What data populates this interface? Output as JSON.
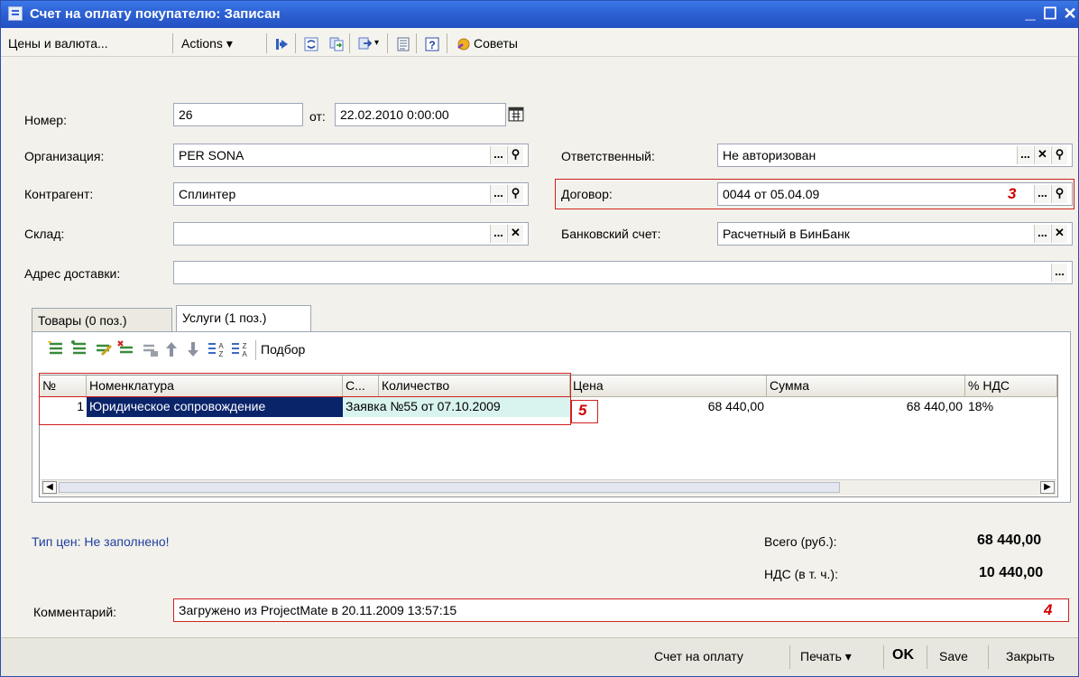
{
  "window": {
    "title": "Счет на оплату покупателю: Записан",
    "controls": [
      "_",
      "☐",
      "✕"
    ]
  },
  "toolbar": {
    "prices_label": "Цены и валюта...",
    "actions_label": "Actions",
    "tips_label": "Советы",
    "icons": [
      "arrow-icon",
      "refresh-icon",
      "copy-icon",
      "structure-icon",
      "list-icon",
      "help-icon",
      "tips-icon"
    ]
  },
  "form": {
    "number_label": "Номер:",
    "number_value": "26",
    "from_label": "от:",
    "date_value": "22.02.2010  0:00:00",
    "organization_label": "Организация:",
    "organization_value": "PER SONA",
    "responsible_label": "Ответственный:",
    "responsible_value": "Не авторизован",
    "counterparty_label": "Контрагент:",
    "counterparty_value": "Сплинтер",
    "contract_label": "Договор:",
    "contract_value": "0044 от 05.04.09",
    "contract_marker": "3",
    "warehouse_label": "Склад:",
    "warehouse_value": "",
    "bank_account_label": "Банковский счет:",
    "bank_account_value": "Расчетный в БинБанк",
    "delivery_label": "Адрес доставки:",
    "delivery_value": ""
  },
  "tabs": [
    {
      "label": "Товары (0 поз.)",
      "active": false
    },
    {
      "label": "Услуги (1 поз.)",
      "active": true
    }
  ],
  "table_toolbar": {
    "pick_label": "Подбор"
  },
  "table": {
    "columns": [
      "№",
      "Номенклатура",
      "С...",
      "Количество",
      "Цена",
      "Сумма",
      "% НДС"
    ],
    "rows": [
      {
        "num": "1",
        "nomenclature": "Юридическое сопровождение",
        "content": "Заявка №55 от 07.10.2009",
        "price": "68 440,00",
        "sum": "68 440,00",
        "vat": "18%"
      }
    ],
    "marker": "5"
  },
  "summary": {
    "price_type": "Тип цен: Не заполнено!",
    "total_label": "Всего (руб.):",
    "total_value": "68 440,00",
    "vat_label": "НДС (в т. ч.):",
    "vat_value": "10 440,00"
  },
  "comment": {
    "label": "Комментарий:",
    "value": "Загружено из ProjectMate в 20.11.2009 13:57:15",
    "marker": "4"
  },
  "bottom": {
    "invoice_label": "Счет на оплату",
    "print_label": "Печать",
    "ok_label": "OK",
    "save_label": "Save",
    "close_label": "Закрыть"
  },
  "colors": {
    "title_bar": "#2e63d6",
    "selection": "#0a246a",
    "marker": "#d10000",
    "price_type_text": "#1f3fa0",
    "content_cell": "#d9f3ee"
  }
}
